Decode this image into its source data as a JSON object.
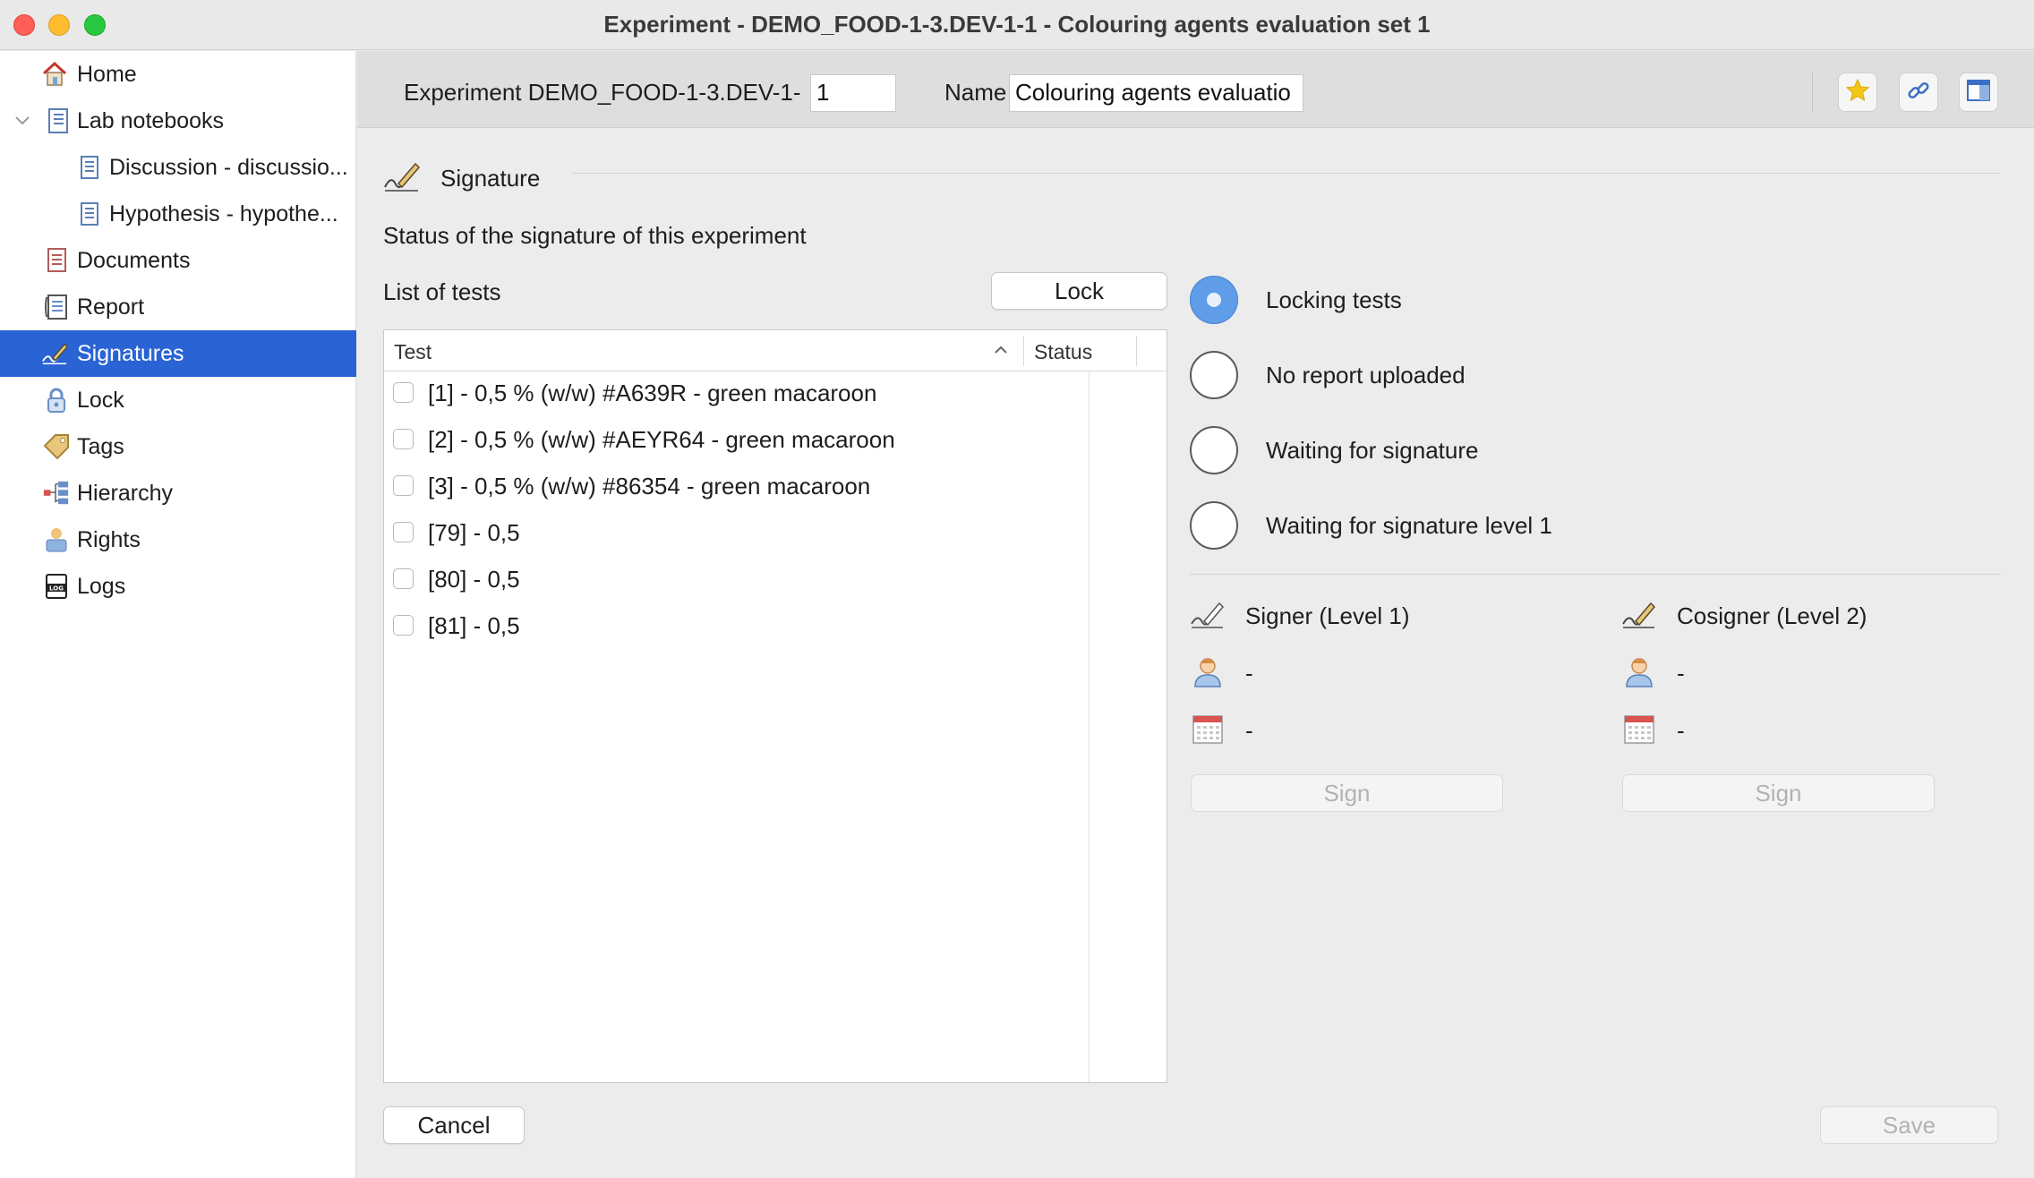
{
  "window": {
    "title": "Experiment - DEMO_FOOD-1-3.DEV-1-1 - Colouring agents evaluation set 1"
  },
  "sidebar": {
    "items": [
      {
        "label": "Home",
        "icon": "home-icon"
      },
      {
        "label": "Lab notebooks",
        "icon": "notebook-icon",
        "expanded": true
      },
      {
        "label": "Discussion - discussio...",
        "icon": "page-icon"
      },
      {
        "label": "Hypothesis - hypothe...",
        "icon": "page-icon"
      },
      {
        "label": "Documents",
        "icon": "documents-icon"
      },
      {
        "label": "Report",
        "icon": "report-icon"
      },
      {
        "label": "Signatures",
        "icon": "signature-icon",
        "selected": true
      },
      {
        "label": "Lock",
        "icon": "lock-icon"
      },
      {
        "label": "Tags",
        "icon": "tag-icon"
      },
      {
        "label": "Hierarchy",
        "icon": "hierarchy-icon"
      },
      {
        "label": "Rights",
        "icon": "rights-icon"
      },
      {
        "label": "Logs",
        "icon": "log-icon"
      }
    ]
  },
  "header": {
    "experiment_label": "Experiment DEMO_FOOD-1-3.DEV-1-",
    "experiment_value": "1",
    "name_label": "Name",
    "name_value": "Colouring agents evaluatio"
  },
  "signature": {
    "section_title": "Signature",
    "status_caption": "Status of the signature of this experiment",
    "tests_label": "List of tests",
    "lock_button": "Lock",
    "columns": {
      "test": "Test",
      "status": "Status"
    },
    "tests": [
      {
        "label": "[1] - 0,5 % (w/w) #A639R - green macaroon",
        "status": ""
      },
      {
        "label": "[2] - 0,5 % (w/w) #AEYR64 - green macaroon",
        "status": ""
      },
      {
        "label": "[3] - 0,5 % (w/w) #86354 - green macaroon",
        "status": ""
      },
      {
        "label": "[79] - 0,5",
        "status": ""
      },
      {
        "label": "[80] - 0,5",
        "status": ""
      },
      {
        "label": "[81] - 0,5",
        "status": ""
      }
    ],
    "statuses": [
      {
        "label": "Locking tests",
        "active": true
      },
      {
        "label": "No report uploaded",
        "active": false
      },
      {
        "label": "Waiting for signature",
        "active": false
      },
      {
        "label": "Waiting for signature level 1",
        "active": false
      }
    ],
    "signer": {
      "title": "Signer (Level 1)",
      "user": "-",
      "date": "-",
      "sign_button": "Sign"
    },
    "cosigner": {
      "title": "Cosigner (Level 2)",
      "user": "-",
      "date": "-",
      "sign_button": "Sign"
    }
  },
  "footer": {
    "cancel_button": "Cancel",
    "save_button": "Save"
  },
  "colors": {
    "selection": "#2a63d4",
    "radio_active": "#5f9de8"
  }
}
